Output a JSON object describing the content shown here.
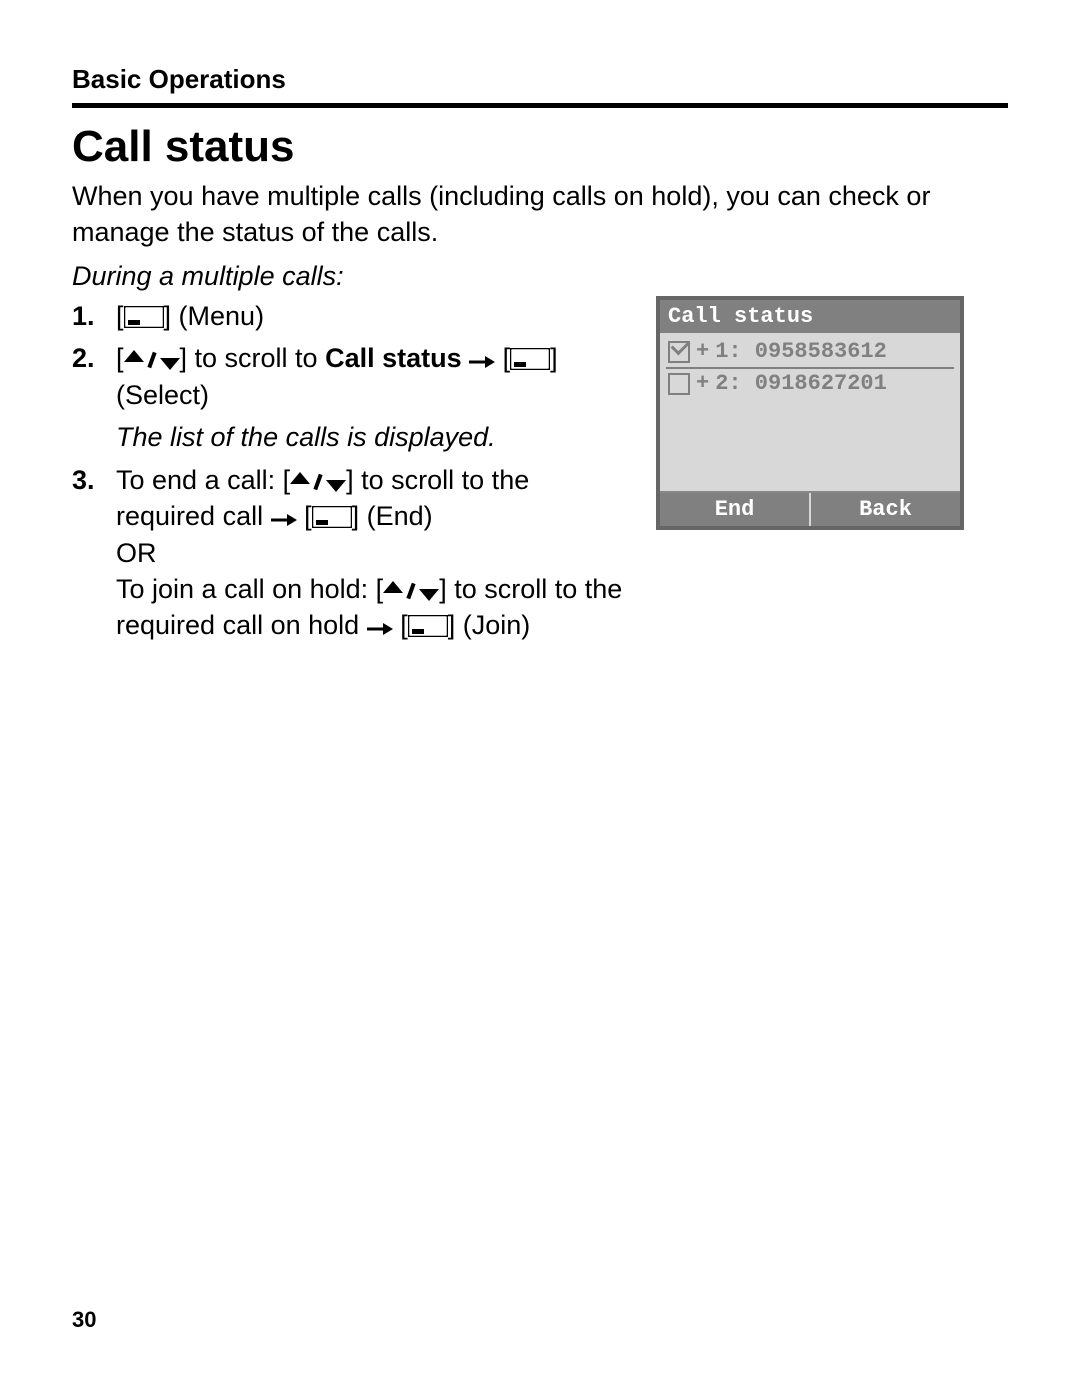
{
  "section": "Basic Operations",
  "title": "Call status",
  "intro": "When you have multiple calls (including calls on hold), you can check or manage the status of the calls.",
  "subhead": "During a multiple calls:",
  "steps": {
    "s1": {
      "num": "1.",
      "a": " (Menu)"
    },
    "s2": {
      "num": "2.",
      "a": " to scroll to ",
      "bold": "Call status",
      "b": " ",
      "c": " (Select)",
      "note": "The list of the calls is displayed."
    },
    "s3": {
      "num": "3.",
      "a": "To end a call: ",
      "b": " to scroll to the required call ",
      "c": " (End)",
      "or": "OR",
      "d": "To join a call on hold: ",
      "e": " to scroll to the required call on hold ",
      "f": " (Join)"
    }
  },
  "phone": {
    "title": "Call status",
    "row1": "1: 0958583612",
    "row2": "2: 0918627201",
    "left_sk": "End",
    "right_sk": "Back"
  },
  "page_number": "30"
}
